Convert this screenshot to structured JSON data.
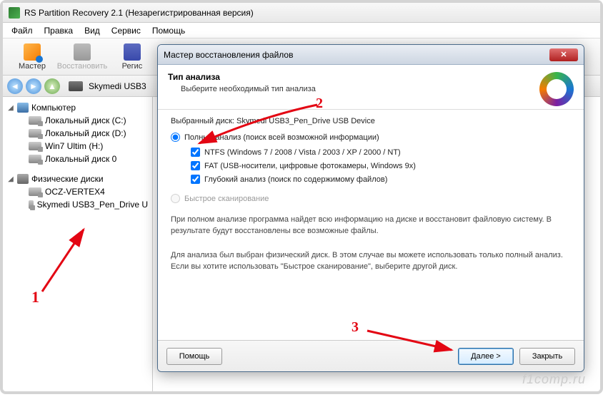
{
  "window": {
    "title": "RS Partition Recovery 2.1 (Незарегистрированная версия)"
  },
  "menu": {
    "file": "Файл",
    "edit": "Правка",
    "view": "Вид",
    "service": "Сервис",
    "help": "Помощь"
  },
  "toolbar": {
    "master": "Мастер",
    "restore": "Восстановить",
    "region": "Регис"
  },
  "nav": {
    "path": "Skymedi USB3"
  },
  "tree": {
    "computer": "Компьютер",
    "items": [
      {
        "label": "Локальный диск (C:)"
      },
      {
        "label": "Локальный диск (D:)"
      },
      {
        "label": "Win7 Ultim (H:)"
      },
      {
        "label": "Локальный диск 0"
      }
    ],
    "physical": "Физические диски",
    "phys_items": [
      {
        "label": "OCZ-VERTEX4"
      },
      {
        "label": "Skymedi USB3_Pen_Drive U"
      }
    ]
  },
  "dialog": {
    "title": "Мастер восстановления файлов",
    "heading": "Тип анализа",
    "subheading": "Выберите необходимый тип анализа",
    "disk_label": "Выбранный диск: Skymedi USB3_Pen_Drive USB Device",
    "full_analysis": "Полный анализ (поиск всей возможной информации)",
    "ntfs": "NTFS (Windows 7 / 2008 / Vista / 2003 / XP / 2000 / NT)",
    "fat": "FAT (USB-носители, цифровые фотокамеры, Windows 9x)",
    "deep": "Глубокий анализ (поиск по содержимому файлов)",
    "quick": "Быстрое сканирование",
    "info1": "При полном анализе программа найдет всю информацию на диске и восстановит файловую систему. В результате будут восстановлены все возможные файлы.",
    "info2": "Для анализа был выбран физический диск. В этом случае вы можете использовать только полный анализ. Если вы хотите использовать \"Быстрое сканирование\", выберите другой диск.",
    "help_btn": "Помощь",
    "next_btn": "Далее >",
    "close_btn": "Закрыть"
  },
  "annotations": {
    "n1": "1",
    "n2": "2",
    "n3": "3"
  },
  "watermark": "f1comp.ru"
}
